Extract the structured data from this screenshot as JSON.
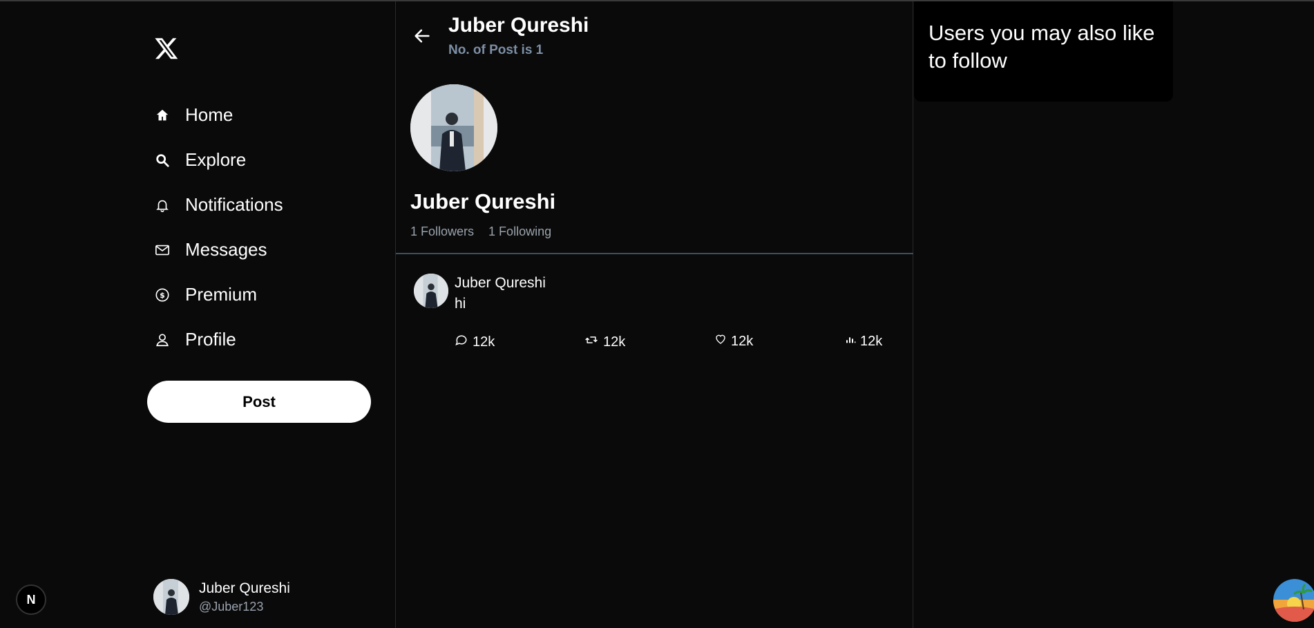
{
  "sidebar": {
    "logo_icon": "x-logo-icon",
    "items": [
      {
        "label": "Home",
        "icon": "home-icon"
      },
      {
        "label": "Explore",
        "icon": "search-icon"
      },
      {
        "label": "Notifications",
        "icon": "bell-icon"
      },
      {
        "label": "Messages",
        "icon": "mail-icon"
      },
      {
        "label": "Premium",
        "icon": "dollar-circle-icon"
      },
      {
        "label": "Profile",
        "icon": "person-icon"
      }
    ],
    "post_label": "Post",
    "account": {
      "name": "Juber Qureshi",
      "handle": "@Juber123"
    }
  },
  "header": {
    "title": "Juber Qureshi",
    "subtitle": "No. of Post is 1"
  },
  "profile": {
    "name": "Juber Qureshi",
    "followers": "1 Followers",
    "following": "1 Following"
  },
  "posts": [
    {
      "author": "Juber Qureshi",
      "text": "hi",
      "replies": "12k",
      "retweets": "12k",
      "likes": "12k",
      "views": "12k"
    }
  ],
  "suggestions": {
    "title": "Users you may also like to follow"
  },
  "badge": {
    "letter": "N"
  },
  "colors": {
    "background": "#0a0a0a",
    "subtitle": "#7d8fa6",
    "muted": "#9aa3ad",
    "divider": "#3e4f5e"
  }
}
